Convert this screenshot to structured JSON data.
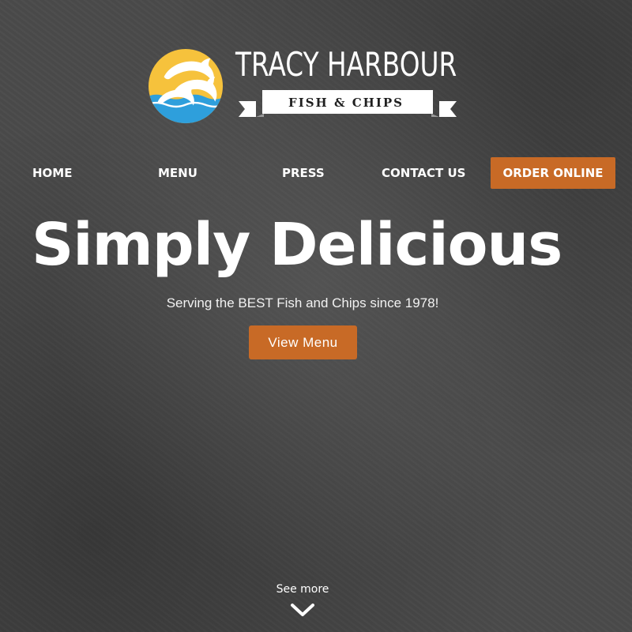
{
  "brand": {
    "title": "TRACY HARBOUR",
    "subtitle": "FISH & CHIPS",
    "logo_icon": "dolphins-sun-logo-icon",
    "colors": {
      "sun": "#f6c23c",
      "sea": "#2e9fdc",
      "ribbon": "#ffffff"
    }
  },
  "nav": {
    "items": [
      {
        "label": "HOME"
      },
      {
        "label": "MENU"
      },
      {
        "label": "PRESS"
      },
      {
        "label": "CONTACT US"
      }
    ],
    "order_label": "ORDER ONLINE"
  },
  "hero": {
    "title": "Simply Delicious",
    "subtitle": "Serving the BEST Fish and Chips since 1978!",
    "button_label": "View Menu"
  },
  "see_more": {
    "label": "See more",
    "icon": "chevron-down-icon"
  },
  "colors": {
    "accent": "#c86a26",
    "background": "#4a4a4a",
    "text": "#ffffff"
  }
}
